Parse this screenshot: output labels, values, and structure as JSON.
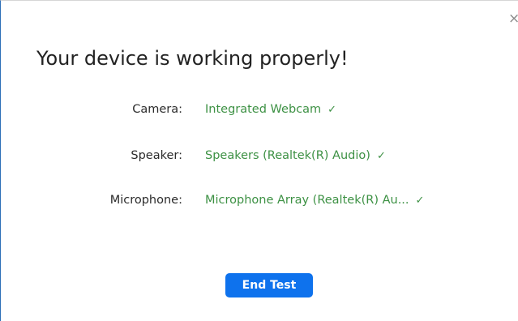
{
  "dialog": {
    "close_glyph": "×",
    "title": "Your device is working properly!",
    "devices": {
      "camera": {
        "label": "Camera:",
        "value": "Integrated Webcam",
        "status_icon": "check-icon"
      },
      "speaker": {
        "label": "Speaker:",
        "value": "Speakers (Realtek(R) Audio)",
        "status_icon": "check-icon"
      },
      "microphone": {
        "label": "Microphone:",
        "value": "Microphone Array (Realtek(R) Au...",
        "status_icon": "check-icon"
      }
    },
    "end_test_label": "End Test",
    "colors": {
      "accent": "#0e72ed",
      "success": "#3d9144",
      "text": "#222222"
    }
  }
}
